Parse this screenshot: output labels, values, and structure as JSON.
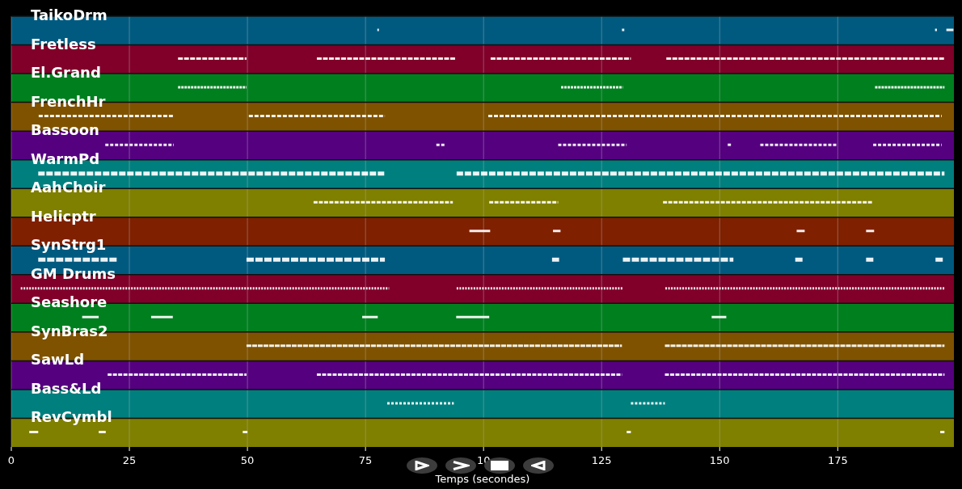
{
  "tracks": [
    {
      "name": "TaikoDrm",
      "color": "#005a80"
    },
    {
      "name": "Fretless",
      "color": "#80002a"
    },
    {
      "name": "El.Grand",
      "color": "#007f1f"
    },
    {
      "name": "FrenchHr",
      "color": "#7f5200"
    },
    {
      "name": "Bassoon",
      "color": "#55007f"
    },
    {
      "name": "WarmPd",
      "color": "#007f7f"
    },
    {
      "name": "AahChoir",
      "color": "#7f7f00"
    },
    {
      "name": "Helicptr",
      "color": "#7f2000"
    },
    {
      "name": "SynStrg1",
      "color": "#005a80"
    },
    {
      "name": "GM Drums",
      "color": "#80002a"
    },
    {
      "name": "Seashore",
      "color": "#007f1f"
    },
    {
      "name": "SynBras2",
      "color": "#7f5200"
    },
    {
      "name": "SawLd",
      "color": "#55007f"
    },
    {
      "name": "Bass&Ld",
      "color": "#007f7f"
    },
    {
      "name": "RevCymbl",
      "color": "#7f7f00"
    }
  ],
  "axis": {
    "ticks": [
      "0",
      "25",
      "50",
      "75",
      "10",
      "125",
      "150",
      "175"
    ],
    "title": "Temps (secondes)"
  },
  "controls": [
    {
      "kind": "play"
    },
    {
      "kind": "forward"
    },
    {
      "kind": "stop"
    },
    {
      "kind": "back"
    }
  ]
}
